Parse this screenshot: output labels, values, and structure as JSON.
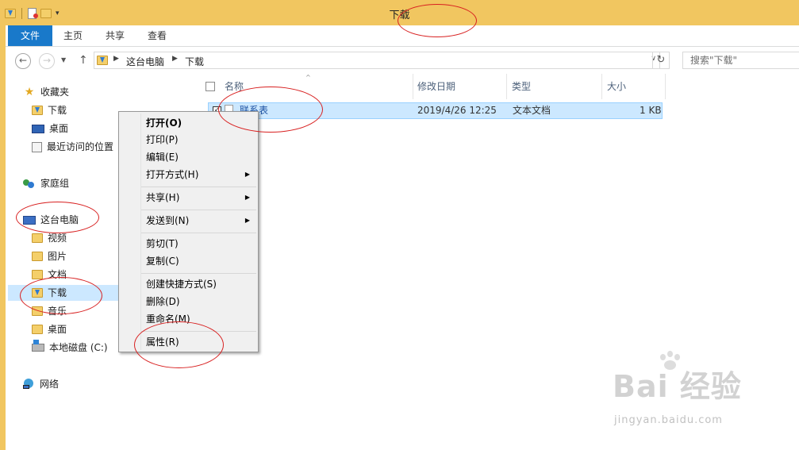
{
  "window": {
    "title": "下载"
  },
  "ribbon": {
    "tabs": [
      "文件",
      "主页",
      "共享",
      "查看"
    ]
  },
  "address": {
    "crumbs": [
      "这台电脑",
      "下载"
    ],
    "search_placeholder": "搜索\"下载\""
  },
  "nav": {
    "favorites": {
      "label": "收藏夹",
      "items": [
        "下载",
        "桌面",
        "最近访问的位置"
      ]
    },
    "homegroup": "家庭组",
    "this_pc": {
      "label": "这台电脑",
      "items": [
        "视频",
        "图片",
        "文档",
        "下载",
        "音乐",
        "桌面",
        "本地磁盘 (C:)"
      ]
    },
    "network": "网络",
    "selected": "下载"
  },
  "file_list": {
    "columns": [
      "名称",
      "修改日期",
      "类型",
      "大小"
    ],
    "rows": [
      {
        "name": "联系表",
        "modified": "2019/4/26 12:25",
        "type": "文本文档",
        "size": "1 KB"
      }
    ]
  },
  "context_menu": {
    "items": [
      "打开(O)",
      "打印(P)",
      "编辑(E)",
      "打开方式(H)",
      "共享(H)",
      "发送到(N)",
      "剪切(T)",
      "复制(C)",
      "创建快捷方式(S)",
      "删除(D)",
      "重命名(M)",
      "属性(R)"
    ]
  },
  "watermark": {
    "logo": "Bai 经验",
    "url": "jingyan.baidu.com"
  },
  "colors": {
    "title_bar": "#f1c660",
    "file_tab": "#1979ca",
    "selection": "#cce8ff",
    "annotation": "#d82020"
  }
}
